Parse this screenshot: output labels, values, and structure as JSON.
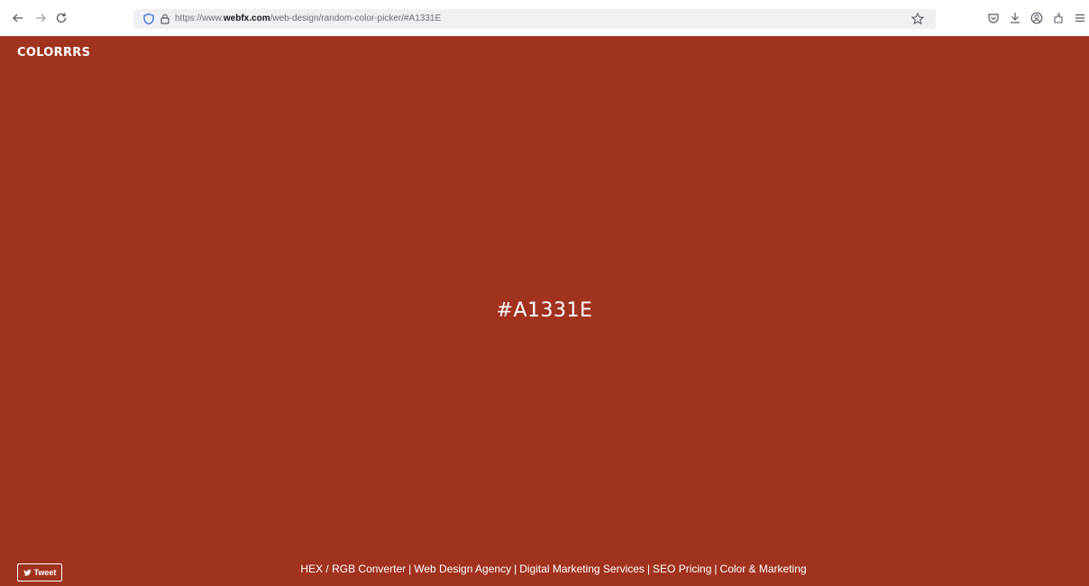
{
  "browser": {
    "url_prefix": "https://www.",
    "url_domain": "webfx.com",
    "url_path": "/web-design/random-color-picker/#A1331E",
    "icons": [
      "back-arrow-icon",
      "forward-arrow-icon",
      "reload-icon",
      "shield-icon",
      "lock-icon",
      "star-icon",
      "pocket-icon",
      "download-icon",
      "account-icon",
      "extensions-icon",
      "menu-icon"
    ]
  },
  "page": {
    "brand": "COLORRRS",
    "hex": "#A1331E",
    "background_color": "#A1331E",
    "tweet_label": "Tweet",
    "footer_links": [
      "HEX / RGB Converter",
      "Web Design Agency",
      "Digital Marketing Services",
      "SEO Pricing",
      "Color & Marketing"
    ],
    "separator": "|"
  }
}
